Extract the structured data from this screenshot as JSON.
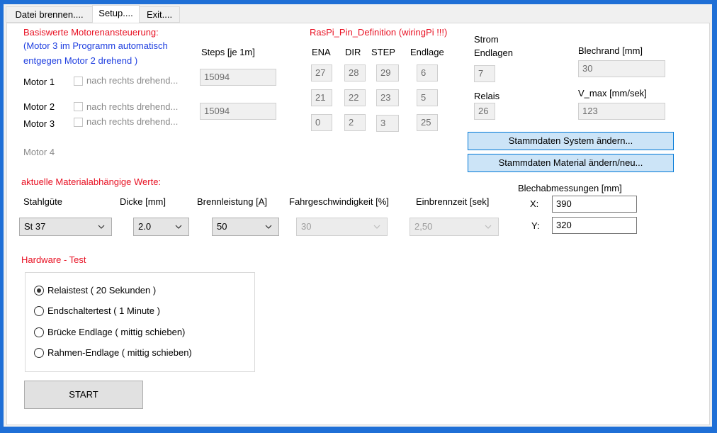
{
  "tabs": [
    "Datei brennen....",
    "Setup....",
    "Exit...."
  ],
  "motor_section": {
    "title": "Basiswerte Motorenansteuerung:",
    "note_line1": "(Motor 3 im Programm automatisch",
    "note_line2": "entgegen Motor 2 drehend )",
    "steps_header": "Steps [je 1m]",
    "motors": [
      {
        "label": "Motor 1",
        "check_label": "nach rechts drehend...",
        "steps": "15094"
      },
      {
        "label": "Motor 2",
        "check_label": "nach rechts drehend...",
        "steps": "15094"
      },
      {
        "label": "Motor 3",
        "check_label": "nach rechts drehend..."
      },
      {
        "label": "Motor 4"
      }
    ]
  },
  "pin_section": {
    "title": "RasPi_Pin_Definition (wiringPi !!!)",
    "headers": [
      "ENA",
      "DIR",
      "STEP",
      "Endlage"
    ],
    "rows": [
      [
        "27",
        "28",
        "29",
        "6"
      ],
      [
        "21",
        "22",
        "23",
        "5"
      ],
      [
        "0",
        "2",
        "3",
        "25"
      ]
    ]
  },
  "strom": {
    "label_line1": "Strom",
    "label_line2": "Endlagen",
    "value": "7"
  },
  "relais": {
    "label": "Relais",
    "value": "26"
  },
  "blechrand": {
    "label": "Blechrand [mm]",
    "value": "30"
  },
  "vmax": {
    "label": "V_max [mm/sek]",
    "value": "123"
  },
  "buttons": {
    "system": "Stammdaten System ändern...",
    "material": "Stammdaten Material ändern/neu..."
  },
  "material_section": {
    "title": "aktuelle Materialabhängige Werte:",
    "stahlguete": {
      "label": "Stahlgüte",
      "value": "St 37"
    },
    "dicke": {
      "label": "Dicke [mm]",
      "value": "2.0"
    },
    "brennleistung": {
      "label": "Brennleistung [A]",
      "value": "50"
    },
    "fahrgeschwindigkeit": {
      "label": "Fahrgeschwindigkeit [%]",
      "value": "30"
    },
    "einbrennzeit": {
      "label": "Einbrennzeit [sek]",
      "value": "2,50"
    }
  },
  "blech": {
    "title": "Blechabmessungen [mm]",
    "x_label": "X:",
    "x_value": "390",
    "y_label": "Y:",
    "y_value": "320"
  },
  "hardware": {
    "title": "Hardware - Test",
    "options": [
      "Relaistest ( 20 Sekunden )",
      "Endschaltertest ( 1 Minute )",
      "Brücke Endlage ( mittig schieben)",
      "Rahmen-Endlage ( mittig schieben)"
    ],
    "selected_index": 0,
    "start_label": "START"
  },
  "colors": {
    "accent_red": "#e81123",
    "note_blue": "#1f3fe0",
    "button_blue": "#cce4f7",
    "background_blue": "#1f6fd6"
  },
  "icons": {
    "combo": "chevron-down-icon"
  }
}
